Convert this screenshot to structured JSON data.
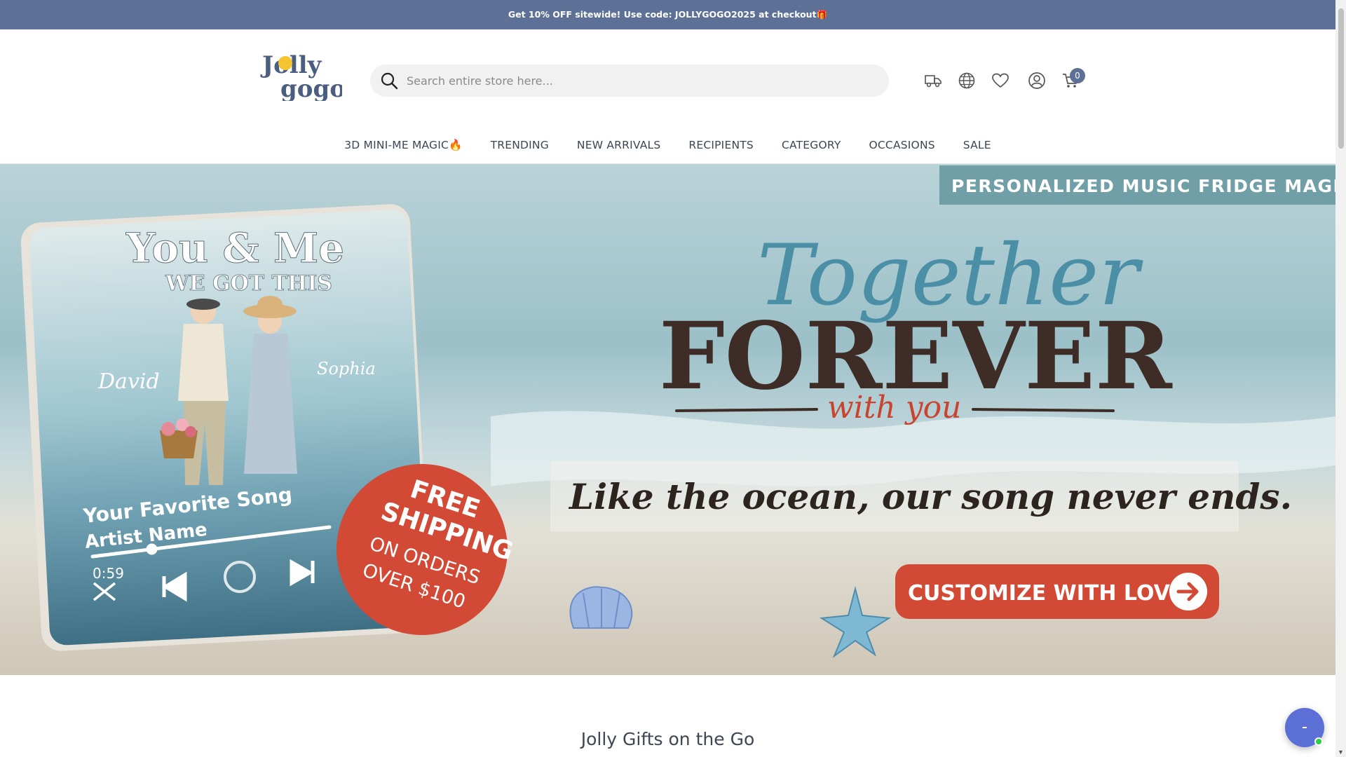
{
  "announcement": {
    "text": "Get 10% OFF sitewide! Use code: JOLLYGOGO2025 at checkout🎁"
  },
  "header": {
    "logo_text_top": "Jolly",
    "logo_text_bottom": "gogo",
    "search_placeholder": "Search entire store here...",
    "cart_count": "0",
    "icons": [
      "truck-icon",
      "globe-icon",
      "heart-icon",
      "account-icon",
      "cart-icon"
    ]
  },
  "nav": {
    "items": [
      "3D MINI-ME MAGIC🔥",
      "TRENDING",
      "NEW ARRIVALS",
      "RECIPIENTS",
      "CATEGORY",
      "OCCASIONS",
      "SALE"
    ]
  },
  "hero": {
    "tag": "PERSONALIZED MUSIC FRIDGE MAGNET",
    "script_title": "Together",
    "big_title": "FOREVER",
    "with_you": "with you",
    "tagline": "Like the ocean, our song never ends.",
    "cta": "CUSTOMIZE WITH LOVE",
    "magnet": {
      "title_line1": "You & Me",
      "title_line2": "WE GOT THIS",
      "name_left": "David",
      "name_right": "Sophia",
      "song": "Your Favorite Song",
      "artist": "Artist Name",
      "time": "0:59",
      "progress": 0.25
    },
    "badge_line1": "FREE",
    "badge_line2": "SHIPPING",
    "badge_line3": "ON ORDERS",
    "badge_line4": "OVER $100"
  },
  "section": {
    "title": "Jolly Gifts on the Go"
  },
  "colors": {
    "announce_bg": "#5d7196",
    "cta_red": "#d24a36",
    "title_brown": "#3e2c26",
    "script_teal": "#4a8fa6"
  }
}
